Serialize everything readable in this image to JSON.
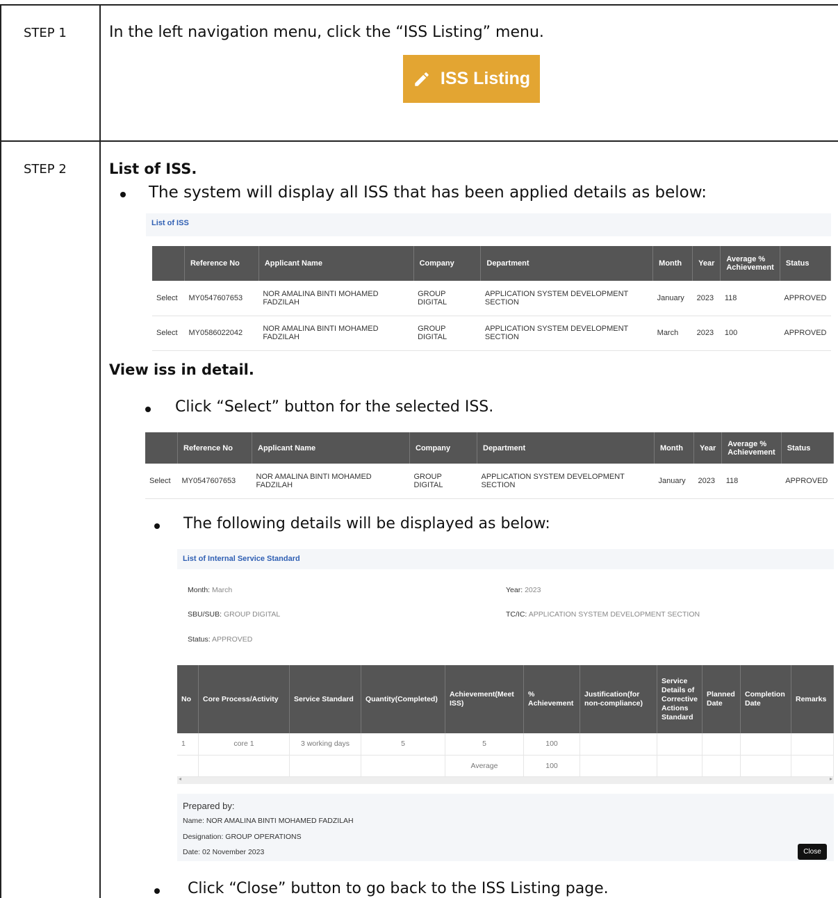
{
  "steps": [
    {
      "label": "STEP 1",
      "instruction": "In the left navigation menu, click the “ISS Listing” menu."
    },
    {
      "label": "STEP 2",
      "heading": "List of ISS.",
      "bullet": "The system will display all ISS that has been applied details as below:"
    }
  ],
  "iss_button": {
    "label": "ISS Listing",
    "color": "#E3A532",
    "icon": "pencil-icon"
  },
  "list_panel": {
    "title": "List of ISS",
    "columns": [
      "",
      "Reference No",
      "Applicant Name",
      "Company",
      "Department",
      "Month",
      "Year",
      "Average % Achievement",
      "Status"
    ],
    "rows": [
      [
        "Select",
        "MY0547607653",
        "NOR AMALINA BINTI MOHAMED FADZILAH",
        "GROUP DIGITAL",
        "APPLICATION SYSTEM DEVELOPMENT SECTION",
        "January",
        "2023",
        "118",
        "APPROVED"
      ],
      [
        "Select",
        "MY0586022042",
        "NOR AMALINA BINTI MOHAMED FADZILAH",
        "GROUP DIGITAL",
        "APPLICATION SYSTEM DEVELOPMENT SECTION",
        "March",
        "2023",
        "100",
        "APPROVED"
      ]
    ]
  },
  "view_section": {
    "heading": "View iss in detail.",
    "bullet1": "Click “Select” button for the selected ISS.",
    "bullet2": "The following details will be displayed as below:",
    "bullet3": "Click “Close” button to go back to the ISS Listing page."
  },
  "selected_row": [
    "Select",
    "MY0547607653",
    "NOR AMALINA BINTI MOHAMED FADZILAH",
    "GROUP DIGITAL",
    "APPLICATION SYSTEM DEVELOPMENT SECTION",
    "January",
    "2023",
    "118",
    "APPROVED"
  ],
  "detail": {
    "title": "List of Internal Service Standard",
    "month_label": "Month:",
    "month_value": "March",
    "year_label": "Year:",
    "year_value": "2023",
    "sbu_label": "SBU/SUB:",
    "sbu_value": "GROUP DIGITAL",
    "tcic_label": "TC/IC:",
    "tcic_value": "APPLICATION SYSTEM DEVELOPMENT SECTION",
    "status_label": "Status:",
    "status_value": "APPROVED",
    "columns": [
      "No",
      "Core Process/Activity",
      "Service Standard",
      "Quantity(Completed)",
      "Achievement(Meet ISS)",
      "% Achievement",
      "Justification(for non-compliance)",
      "Service Details of Corrective Actions Standard",
      "Planned Date",
      "Completion Date",
      "Remarks"
    ],
    "rows": [
      [
        "1",
        "core 1",
        "3 working days",
        "5",
        "5",
        "100",
        "",
        "",
        "",
        "",
        ""
      ],
      [
        "",
        "",
        "",
        "",
        "Average",
        "100",
        "",
        "",
        "",
        "",
        ""
      ]
    ],
    "prepared_by": "Prepared by:",
    "name": "Name: NOR AMALINA BINTI MOHAMED FADZILAH",
    "designation": "Designation: GROUP OPERATIONS",
    "date": "Date: 02 November 2023",
    "close_label": "Close"
  }
}
